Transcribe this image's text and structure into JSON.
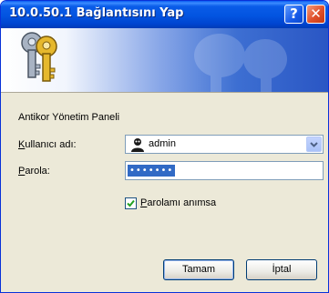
{
  "window": {
    "title": "10.0.50.1 Bağlantısını Yap",
    "help_label": "?",
    "close_label": "✕"
  },
  "form": {
    "realm": "Antikor Yönetim Paneli",
    "username_label_accel": "K",
    "username_label_rest": "ullanıcı adı:",
    "username_value": "admin",
    "password_label_accel": "P",
    "password_label_rest": "arola:",
    "password_mask": "•••••••",
    "remember_accel": "P",
    "remember_rest": "arolamı anımsa",
    "remember_checked": true
  },
  "buttons": {
    "ok_label": "Tamam",
    "cancel_label": "İptal"
  },
  "colors": {
    "title_bar": "#0a5ce8",
    "dialog_bg": "#ece9d8",
    "selection": "#316ac5",
    "close_button": "#e0502a"
  },
  "icons": {
    "banner": "keys-icon",
    "user": "user-avatar-icon",
    "dropdown": "chevron-down-icon",
    "check": "checkmark-icon"
  }
}
